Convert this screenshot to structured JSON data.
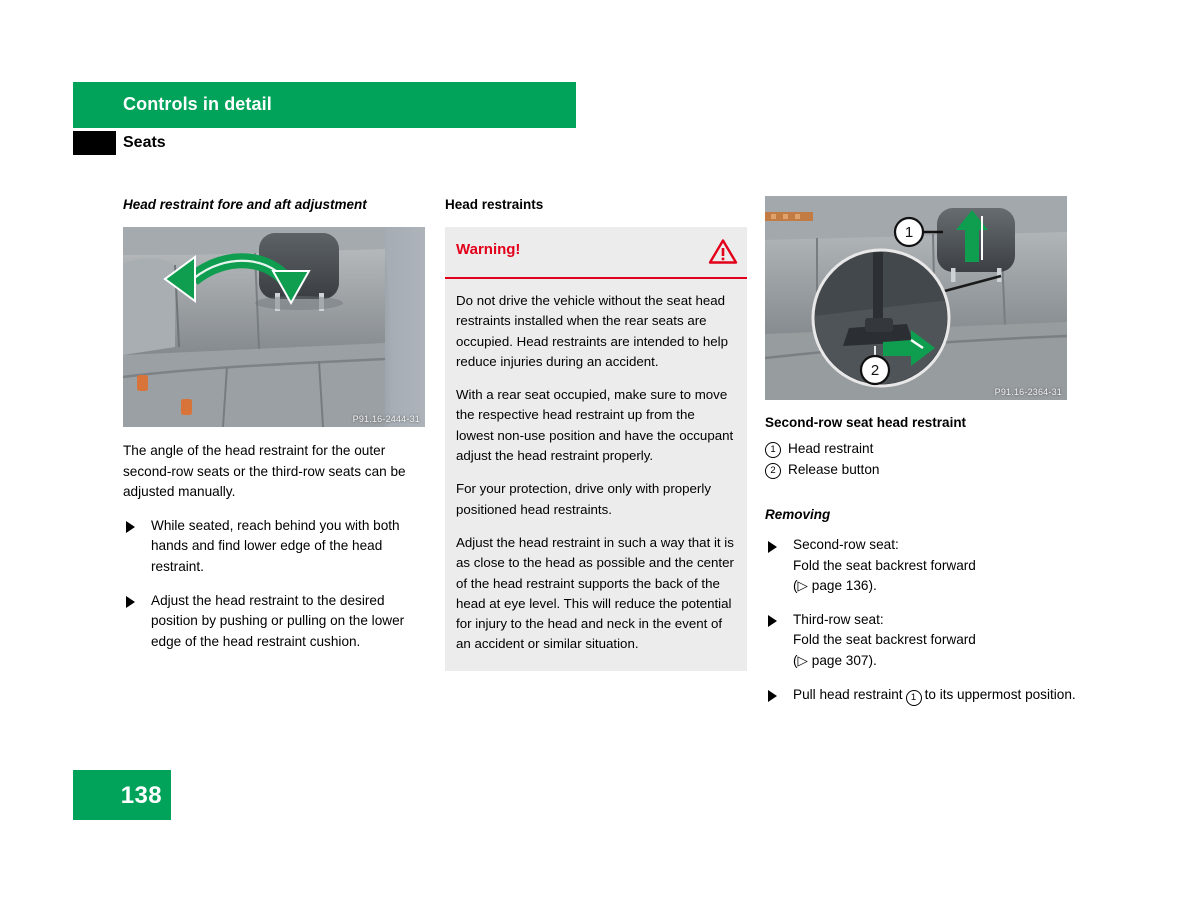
{
  "colors": {
    "brand_green": "#00a359",
    "warning_red": "#e2001a",
    "warning_box_bg": "#ececec",
    "tab_black": "#000000"
  },
  "header": {
    "chapter_title": "Controls in detail",
    "section_title": "Seats"
  },
  "footer": {
    "page_number": "138"
  },
  "left_column": {
    "heading": "Head restraint fore and aft adjustment",
    "figure_caption": "P91.16-2444-31",
    "paragraph": "The angle of the head restraint for the outer second-row seats or the third-row seats can be adjusted manually.",
    "bullets": [
      "While seated, reach behind you with both hands and find lower edge of the head restraint.",
      "Adjust the head restraint to the desired position by pushing or pulling on the lower edge of the head restraint cushion."
    ]
  },
  "middle_column": {
    "heading": "Head restraints",
    "warning": {
      "title": "Warning!",
      "icon": "warning-triangle-icon",
      "paragraphs": [
        "Do not drive the vehicle without the seat head restraints installed when the rear seats are occupied. Head restraints are intended to help reduce injuries during an accident.",
        "With a rear seat occupied, make sure to move the respective head restraint up from the lowest non-use position and have the occupant adjust the head restraint properly.",
        "For your protection, drive only with properly positioned head restraints.",
        "Adjust the head restraint in such a way that it is as close to the head as possible and the center of the head restraint supports the back of the head at eye level. This will reduce the potential for injury to the head and neck in the event of an accident or similar situation."
      ]
    }
  },
  "right_column": {
    "figure_caption": "P91.16-2364-31",
    "figure_callouts": [
      "1",
      "2"
    ],
    "figure_title": "Second-row seat head restraint",
    "legend": [
      {
        "num": "1",
        "label": "Head restraint"
      },
      {
        "num": "2",
        "label": "Release button"
      }
    ],
    "removing_heading": "Removing",
    "removing_steps": [
      {
        "line1": "Second-row seat:",
        "line2": "Fold the seat backrest forward",
        "ref_open": "(▷ page 136).",
        "tail": ""
      },
      {
        "line1": "Third-row seat:",
        "line2": "Fold the seat backrest forward",
        "ref_open": "(▷ page 307).",
        "tail": ""
      }
    ],
    "final_step": {
      "prefix": "Pull head restraint",
      "callout": "1",
      "suffix": "to its uppermost position."
    }
  }
}
